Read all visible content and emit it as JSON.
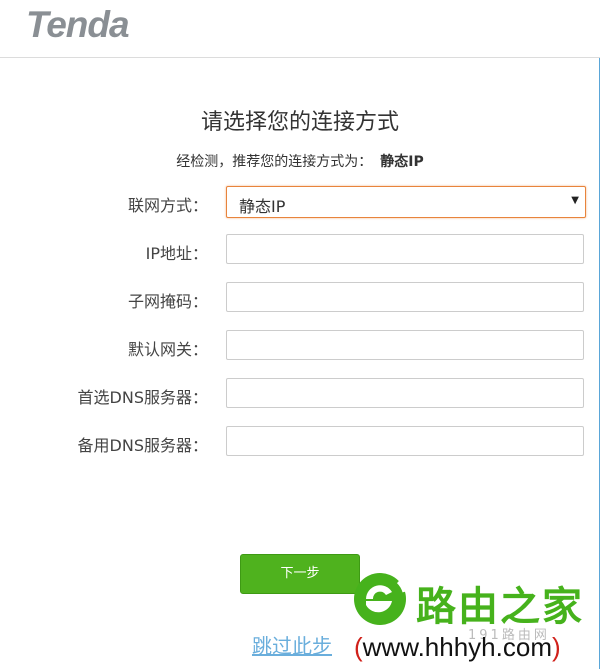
{
  "header": {
    "logo_text": "Tenda"
  },
  "main": {
    "title": "请选择您的连接方式",
    "detect_text": "经检测，推荐您的连接方式为：",
    "detect_value": "静态IP"
  },
  "form": {
    "connection_type": {
      "label": "联网方式：",
      "value": "静态IP"
    },
    "ip_address": {
      "label": "IP地址：",
      "value": ""
    },
    "subnet_mask": {
      "label": "子网掩码：",
      "value": ""
    },
    "default_gateway": {
      "label": "默认网关：",
      "value": ""
    },
    "primary_dns": {
      "label": "首选DNS服务器：",
      "value": ""
    },
    "secondary_dns": {
      "label": "备用DNS服务器：",
      "value": ""
    }
  },
  "actions": {
    "next_label": "下一步",
    "skip_label": "跳过此步"
  },
  "watermark": {
    "name": "路由之家",
    "sub": "191路由网",
    "url_open": "(",
    "url": "www.hhhyh.com",
    "url_close": ")"
  },
  "colors": {
    "accent_green": "#4fb21e",
    "select_border": "#e8843c",
    "link_blue": "#6aaedc",
    "frame_blue": "#5aa6d8"
  }
}
